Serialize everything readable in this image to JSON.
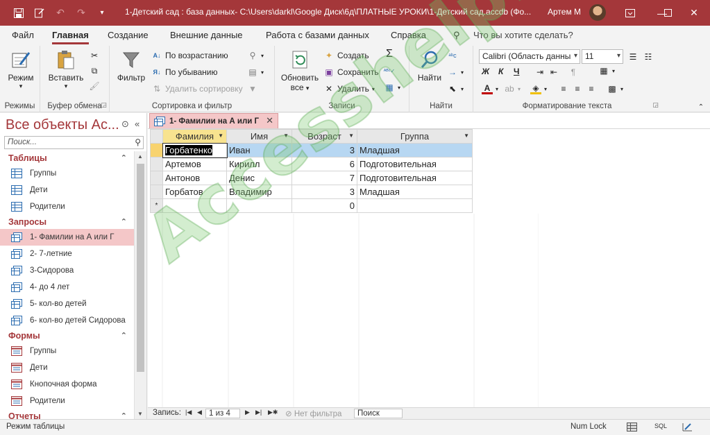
{
  "titlebar": {
    "title": "1-Детский сад : база данных- C:\\Users\\darkl\\Google Диск\\6д\\ПЛАТНЫЕ УРОКИ\\1-Детский сад.accdb (Фо...",
    "user": "Артем М",
    "accent": "#a4373a"
  },
  "tabs": [
    "Файл",
    "Главная",
    "Создание",
    "Внешние данные",
    "Работа с базами данных",
    "Справка"
  ],
  "tell_me": "Что вы хотите сделать?",
  "ribbon": {
    "views": {
      "view_label": "Режим",
      "group": "Режимы"
    },
    "clipboard": {
      "paste_label": "Вставить",
      "group": "Буфер обмена"
    },
    "sort_filter": {
      "filter_label": "Фильтр",
      "ascending": "По возрастанию",
      "descending": "По убыванию",
      "remove_sort": "Удалить сортировку",
      "group": "Сортировка и фильтр"
    },
    "records": {
      "refresh_label": "Обновить",
      "refresh_sub": "все",
      "new": "Создать",
      "save": "Сохранить",
      "delete": "Удалить",
      "group": "Записи"
    },
    "find": {
      "find_label": "Найти",
      "group": "Найти"
    },
    "text_format": {
      "font": "Calibri (Область данны",
      "size": "11",
      "bold": "Ж",
      "italic": "К",
      "underline": "Ч",
      "group": "Форматирование текста"
    }
  },
  "nav": {
    "title": "Все объекты Ac...",
    "search_placeholder": "Поиск...",
    "sections": {
      "tables": {
        "label": "Таблицы",
        "items": [
          "Группы",
          "Дети",
          "Родители"
        ]
      },
      "queries": {
        "label": "Запросы",
        "items": [
          "1- Фамилии на А или Г",
          "2- 7-летние",
          "3-Сидорова",
          "4- до 4 лет",
          "5- кол-во детей",
          "6- кол-во детей Сидорова"
        ]
      },
      "forms": {
        "label": "Формы",
        "items": [
          "Группы",
          "Дети",
          "Кнопочная форма",
          "Родители"
        ]
      },
      "reports": {
        "label": "Отчеты"
      }
    }
  },
  "document": {
    "tab_label": "1- Фамилии на А или Г",
    "columns": [
      "Фамилия",
      "Имя",
      "Возраст",
      "Группа"
    ],
    "rows": [
      [
        "Горбатенко",
        "Иван",
        "3",
        "Младшая"
      ],
      [
        "Артемов",
        "Кирилл",
        "6",
        "Подготовительная"
      ],
      [
        "Антонов",
        "Денис",
        "7",
        "Подготовительная"
      ],
      [
        "Горбатов",
        "Владимир",
        "3",
        "Младшая"
      ]
    ],
    "new_row": {
      "marker": "*",
      "age": "0"
    }
  },
  "record_nav": {
    "label": "Запись:",
    "position": "1 из 4",
    "filter": "Нет фильтра",
    "search": "Поиск"
  },
  "status": {
    "mode": "Режим таблицы",
    "numlock": "Num Lock",
    "sql": "SQL"
  },
  "watermark": "Accesshelp.ru"
}
